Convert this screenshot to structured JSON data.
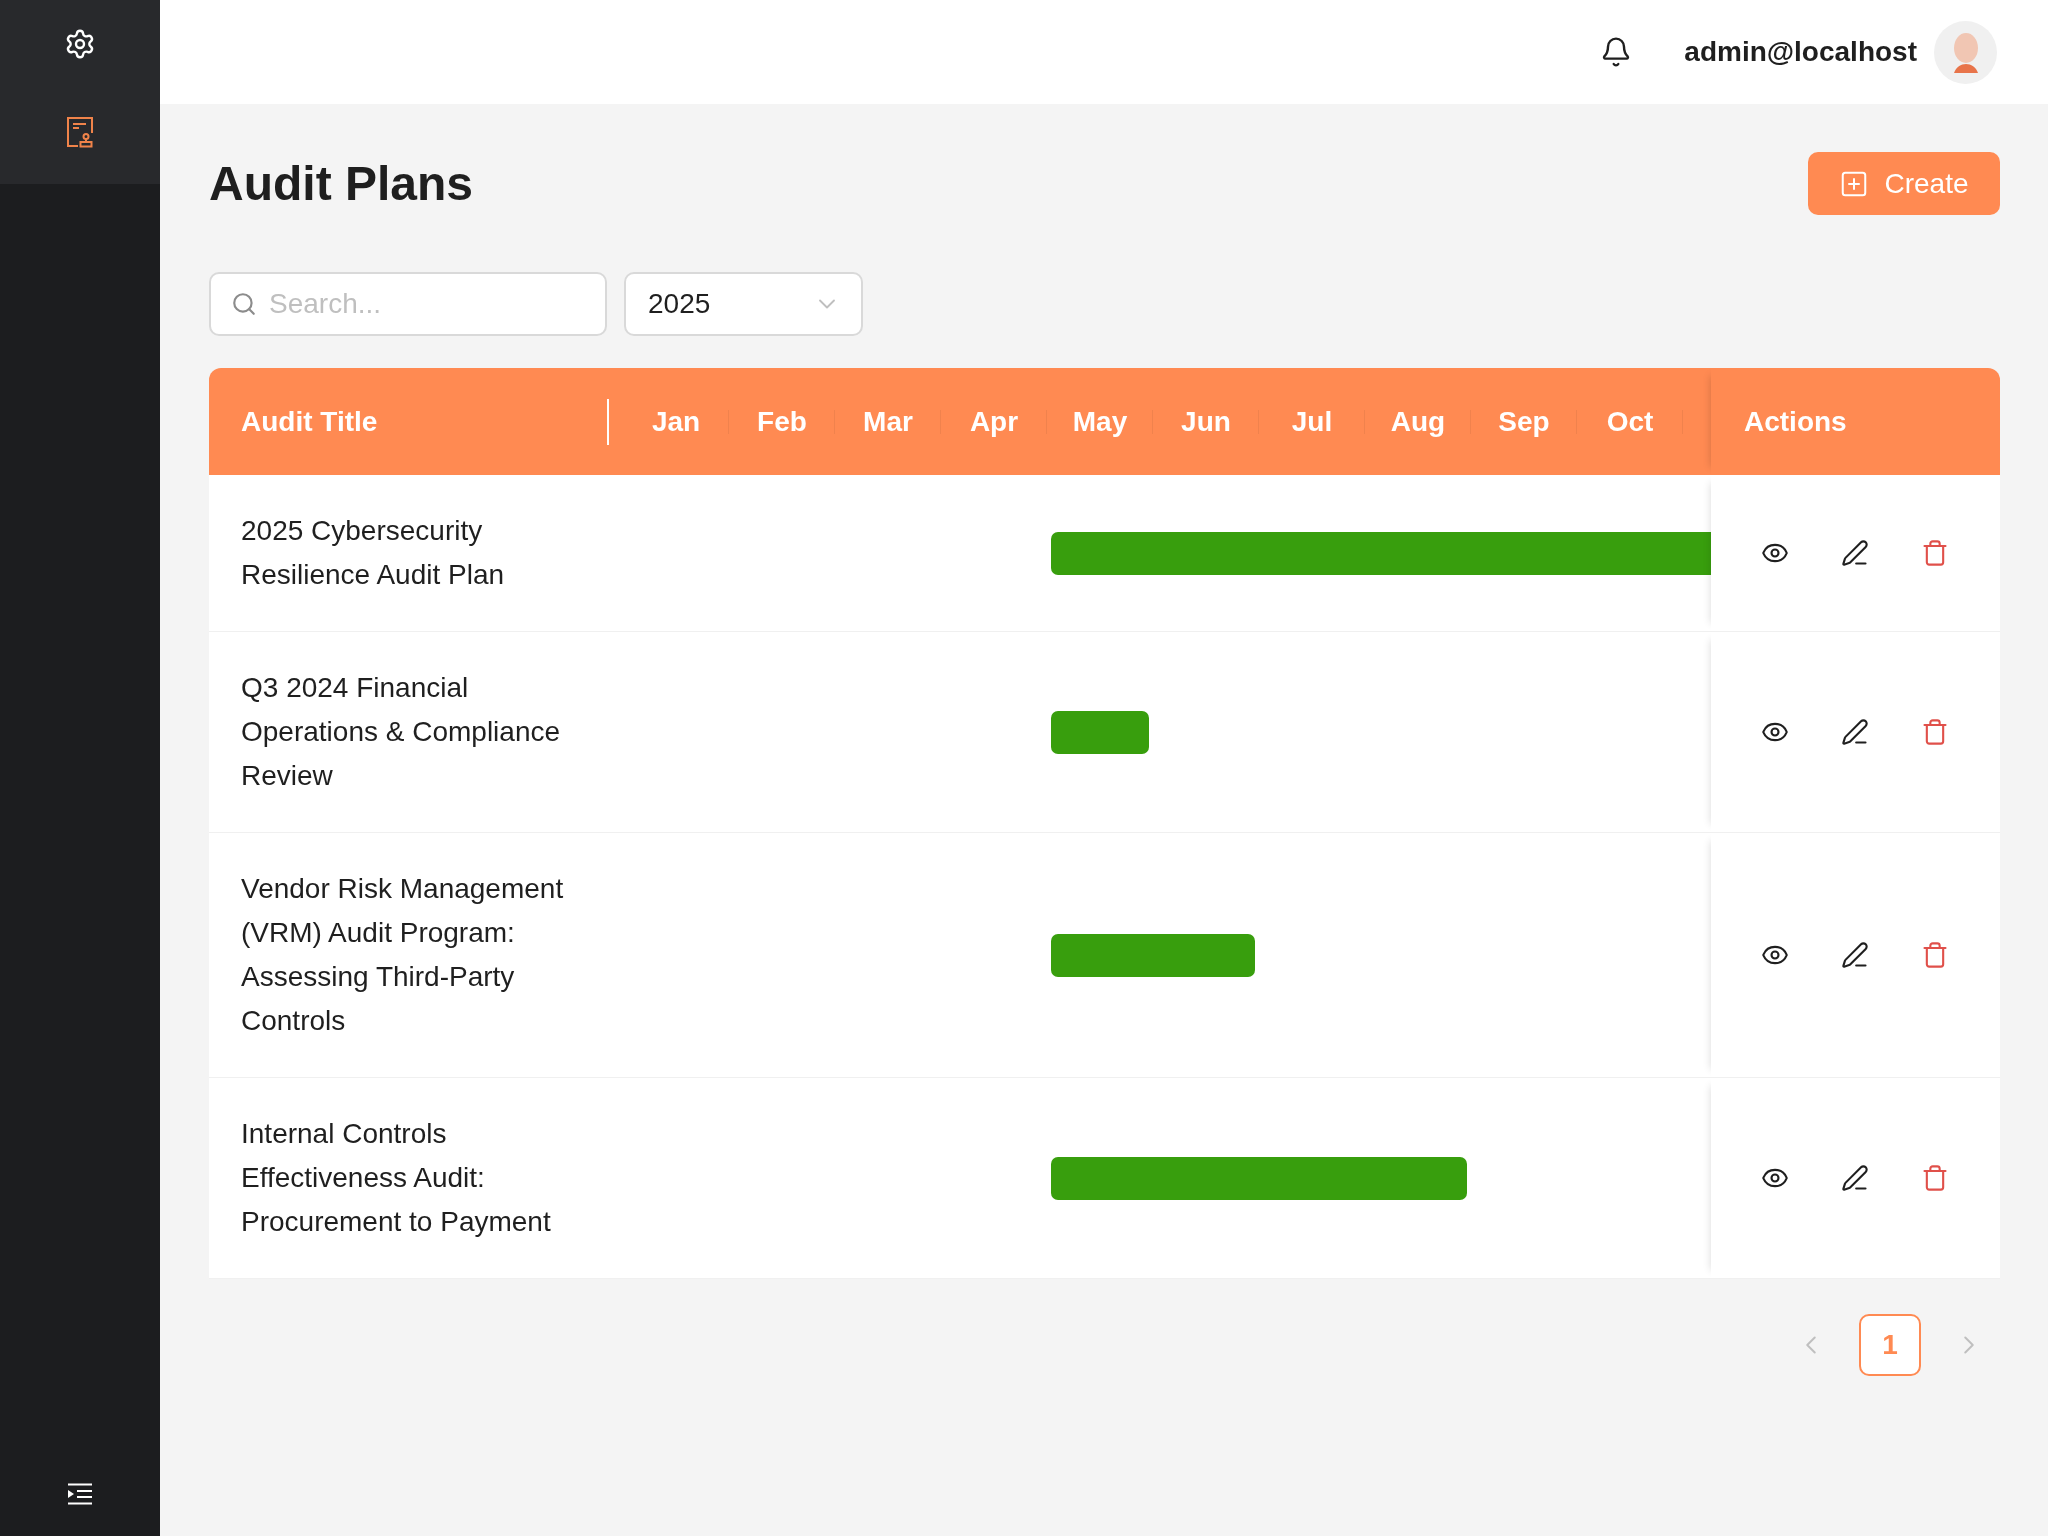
{
  "sidebar": {
    "items": [
      {
        "kind": "settings",
        "selected": false
      },
      {
        "kind": "document",
        "selected": true
      }
    ]
  },
  "top_bar": {
    "user": "admin@localhost"
  },
  "page": {
    "title": "Audit Plans",
    "create_button": "Create"
  },
  "filters": {
    "search": {
      "placeholder": "Search..."
    },
    "year": {
      "value": "2025"
    }
  },
  "table": {
    "columns": {
      "title": "Audit Title",
      "months": [
        "Jan",
        "Feb",
        "Mar",
        "Apr",
        "May",
        "Jun",
        "Jul",
        "Aug",
        "Sep",
        "Oct"
      ],
      "actions": "Actions"
    },
    "rows": [
      {
        "title": "2025 Cybersecurity Resilience Audit Plan",
        "timeline": [
          {
            "kind": "empty"
          },
          {
            "kind": "empty"
          },
          {
            "kind": "empty"
          },
          {
            "kind": "empty"
          },
          {
            "kind": "bar"
          },
          {
            "kind": "bar"
          },
          {
            "kind": "bar"
          },
          {
            "kind": "bar"
          },
          {
            "kind": "bar"
          },
          {
            "kind": "bar"
          },
          {
            "kind": "bar"
          }
        ]
      },
      {
        "title": "Q3 2024 Financial Operations & Compliance Review",
        "timeline": [
          {
            "kind": "empty"
          },
          {
            "kind": "empty"
          },
          {
            "kind": "empty"
          },
          {
            "kind": "empty"
          },
          {
            "kind": "bar"
          },
          {
            "kind": "empty"
          },
          {
            "kind": "empty"
          },
          {
            "kind": "empty"
          },
          {
            "kind": "empty"
          },
          {
            "kind": "empty"
          },
          {
            "kind": "empty"
          }
        ]
      },
      {
        "title": "Vendor Risk Management (VRM) Audit Program: Assessing Third-Party Controls",
        "timeline": [
          {
            "kind": "empty"
          },
          {
            "kind": "empty"
          },
          {
            "kind": "empty"
          },
          {
            "kind": "empty"
          },
          {
            "kind": "bar"
          },
          {
            "kind": "bar"
          },
          {
            "kind": "empty"
          },
          {
            "kind": "empty"
          },
          {
            "kind": "empty"
          },
          {
            "kind": "empty"
          },
          {
            "kind": "empty"
          }
        ]
      },
      {
        "title": "Internal Controls Effectiveness Audit: Procurement to Payment",
        "timeline": [
          {
            "kind": "empty"
          },
          {
            "kind": "empty"
          },
          {
            "kind": "empty"
          },
          {
            "kind": "empty"
          },
          {
            "kind": "bar"
          },
          {
            "kind": "bar"
          },
          {
            "kind": "bar"
          },
          {
            "kind": "bar"
          },
          {
            "kind": "empty"
          },
          {
            "kind": "empty"
          },
          {
            "kind": "empty"
          }
        ]
      }
    ]
  },
  "pagination": {
    "previous": {
      "disabled": true
    },
    "pages": [
      {
        "label": "1",
        "selected": true
      }
    ],
    "next": {
      "disabled": true
    }
  }
}
